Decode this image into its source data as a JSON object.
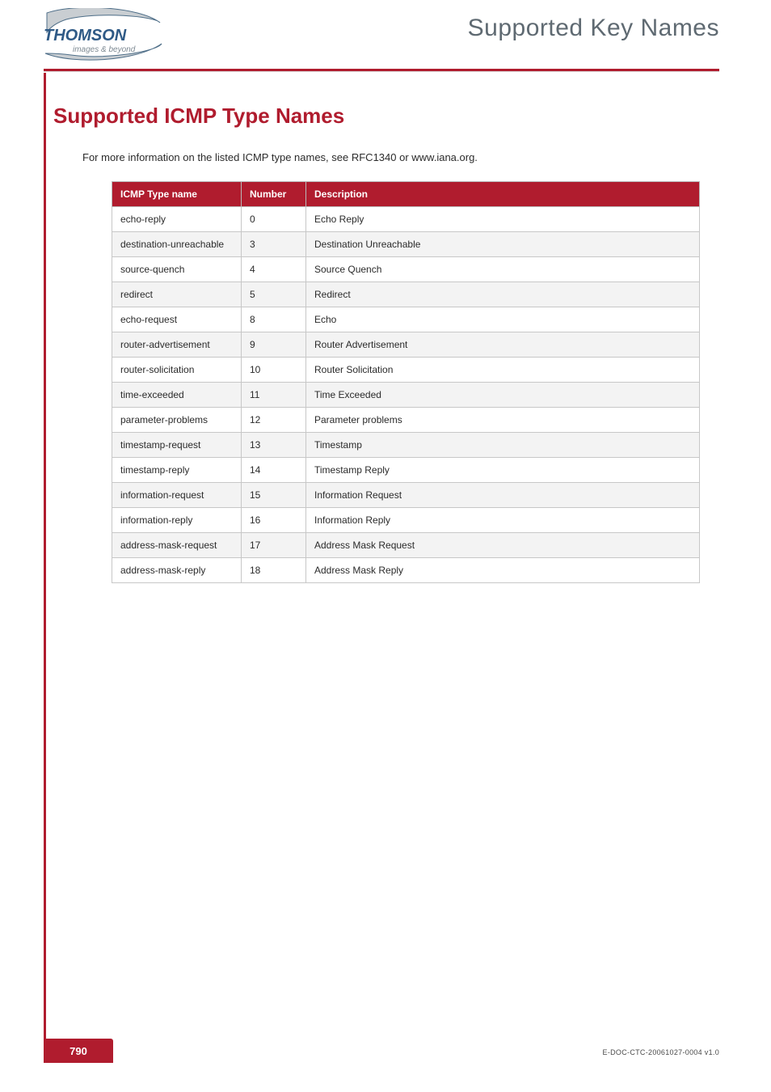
{
  "header": {
    "running_title": "Supported Key Names",
    "brand_main": "THOMSON",
    "brand_tagline": "images & beyond"
  },
  "body": {
    "h1": "Supported ICMP Type Names",
    "lead": "For more information on the listed ICMP type names, see RFC1340 or www.iana.org."
  },
  "table": {
    "headers": {
      "name": "ICMP Type name",
      "number": "Number",
      "description": "Description"
    },
    "rows": [
      {
        "name": "echo-reply",
        "number": "0",
        "description": "Echo Reply"
      },
      {
        "name": "destination-unreachable",
        "number": "3",
        "description": "Destination Unreachable"
      },
      {
        "name": "source-quench",
        "number": "4",
        "description": "Source Quench"
      },
      {
        "name": "redirect",
        "number": "5",
        "description": "Redirect"
      },
      {
        "name": "echo-request",
        "number": "8",
        "description": "Echo"
      },
      {
        "name": "router-advertisement",
        "number": "9",
        "description": "Router Advertisement"
      },
      {
        "name": "router-solicitation",
        "number": "10",
        "description": "Router Solicitation"
      },
      {
        "name": "time-exceeded",
        "number": "11",
        "description": "Time Exceeded"
      },
      {
        "name": "parameter-problems",
        "number": "12",
        "description": "Parameter problems"
      },
      {
        "name": "timestamp-request",
        "number": "13",
        "description": "Timestamp"
      },
      {
        "name": "timestamp-reply",
        "number": "14",
        "description": "Timestamp Reply"
      },
      {
        "name": "information-request",
        "number": "15",
        "description": "Information Request"
      },
      {
        "name": "information-reply",
        "number": "16",
        "description": "Information Reply"
      },
      {
        "name": "address-mask-request",
        "number": "17",
        "description": "Address Mask Request"
      },
      {
        "name": "address-mask-reply",
        "number": "18",
        "description": "Address Mask Reply"
      }
    ]
  },
  "footer": {
    "page_number": "790",
    "doc_id": "E-DOC-CTC-20061027-0004 v1.0"
  }
}
